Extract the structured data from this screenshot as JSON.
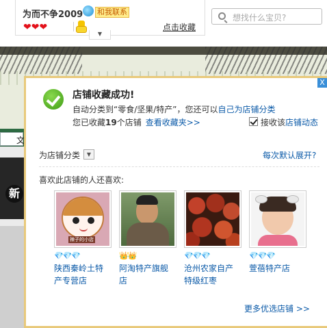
{
  "header": {
    "shop_name": "为而不争2009",
    "contact_label": "和我联系",
    "hearts": "❤❤❤",
    "favorite_link": "点击收藏",
    "dropdown_glyph": "▼"
  },
  "search": {
    "placeholder": "想找什么宝贝?"
  },
  "background": {
    "tab_label": "文",
    "side_char": "新"
  },
  "popup": {
    "close_glyph": "X",
    "title": "店铺收藏成功!",
    "line1_prefix": "自动分类到“零食/坚果/特产”，您还可以",
    "line1_link": "自己为店铺分类",
    "line2_prefix": "您已收藏",
    "line2_count": "19",
    "line2_suffix": "个店铺",
    "line2_link": "查看收藏夹>>",
    "subscribe_prefix": "接收该",
    "subscribe_link": "店铺动态",
    "subscribe_checked": true,
    "category_label": "为店铺分类",
    "category_drop": "▼",
    "expand_link": "每次默认展开?",
    "also_like_title": "喜欢此店铺的人还喜欢:",
    "shops": [
      {
        "name_line1": "陕西秦岭土特",
        "name_line2": "产专营店",
        "rating_icons": "💎💎💎",
        "badge_text": "辣子的小店"
      },
      {
        "name_line1": "阿淘特产旗舰",
        "name_line2": "店",
        "rating_icons": "👑👑",
        "badge_text": ""
      },
      {
        "name_line1": "沧州农家自产",
        "name_line2": "特级红枣",
        "rating_icons": "💎💎💎",
        "badge_text": ""
      },
      {
        "name_line1": "萱蓓特产店",
        "name_line2": "",
        "rating_icons": "💎💎💎",
        "badge_text": ""
      }
    ],
    "more_link": "更多优选店铺 >>"
  },
  "colors": {
    "link": "#0b5aa8",
    "popup_border": "#e8c97a",
    "heart": "#e3111a",
    "success_green": "#3e9b14"
  }
}
